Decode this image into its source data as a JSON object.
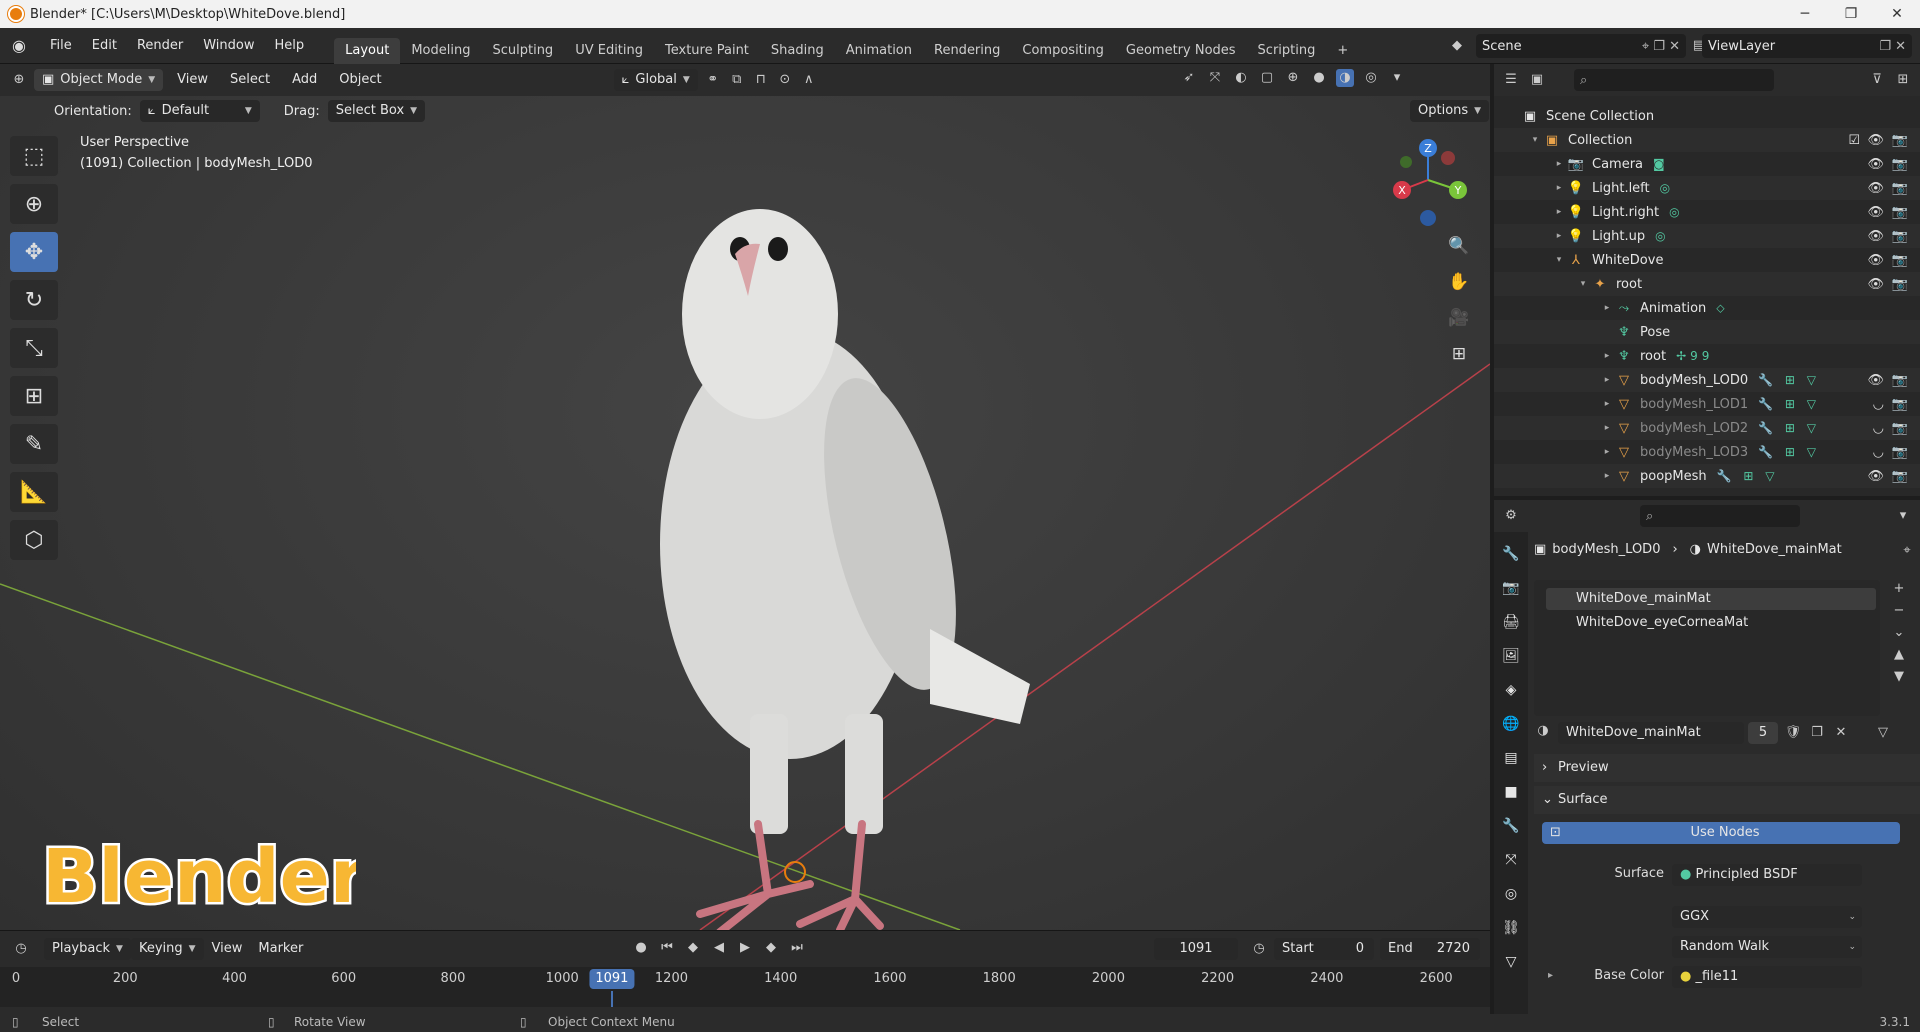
{
  "titlebar": {
    "title": "Blender* [C:\\Users\\M\\Desktop\\WhiteDove.blend]",
    "min": "─",
    "max": "❐",
    "close": "✕"
  },
  "menubar": {
    "menus": [
      "File",
      "Edit",
      "Render",
      "Window",
      "Help"
    ],
    "workspaces": [
      "Layout",
      "Modeling",
      "Sculpting",
      "UV Editing",
      "Texture Paint",
      "Shading",
      "Animation",
      "Rendering",
      "Compositing",
      "Geometry Nodes",
      "Scripting"
    ],
    "active_workspace": "Layout",
    "add_tab": "+",
    "scene": "Scene",
    "view_layer": "ViewLayer"
  },
  "viewport_header": {
    "mode": "Object Mode",
    "menus": [
      "View",
      "Select",
      "Add",
      "Object"
    ],
    "transform_orientation": "Global",
    "orientation_label": "Orientation:",
    "orientation_value": "Default",
    "drag_label": "Drag:",
    "drag_value": "Select Box",
    "options": "Options"
  },
  "viewport": {
    "perspective": "User Perspective",
    "collection_info": "(1091) Collection | bodyMesh_LOD0",
    "gizmo": {
      "x": "X",
      "y": "Y",
      "z": "Z"
    },
    "watermark": "Blender"
  },
  "timeline": {
    "menus": [
      "Playback",
      "Keying",
      "View",
      "Marker"
    ],
    "current_frame": "1091",
    "start_label": "Start",
    "start": "0",
    "end_label": "End",
    "end": "2720",
    "ticks": [
      "0",
      "200",
      "400",
      "600",
      "800",
      "1000",
      "1200",
      "1400",
      "1600",
      "1800",
      "2000",
      "2200",
      "2400",
      "2600"
    ]
  },
  "statusbar": {
    "select": "Select",
    "rotate": "Rotate View",
    "context": "Object Context Menu",
    "version": "3.3.1"
  },
  "outliner": {
    "root": "Scene Collection",
    "rows": [
      {
        "label": "Collection",
        "indent": 1,
        "icon": "collection-icon",
        "glyph": "▣",
        "expand": "▾",
        "vis": true
      },
      {
        "label": "Camera",
        "indent": 2,
        "icon": "camera-icon",
        "glyph": "📷",
        "expand": "▸",
        "vis": true,
        "extra": "◙"
      },
      {
        "label": "Light.left",
        "indent": 2,
        "icon": "light-icon",
        "glyph": "💡",
        "expand": "▸",
        "vis": true,
        "extra": "◎"
      },
      {
        "label": "Light.right",
        "indent": 2,
        "icon": "light-icon",
        "glyph": "💡",
        "expand": "▸",
        "vis": true,
        "extra": "◎"
      },
      {
        "label": "Light.up",
        "indent": 2,
        "icon": "light-icon",
        "glyph": "💡",
        "expand": "▸",
        "vis": true,
        "extra": "◎"
      },
      {
        "label": "WhiteDove",
        "indent": 2,
        "icon": "empty-icon",
        "glyph": "⅄",
        "expand": "▾",
        "vis": true
      },
      {
        "label": "root",
        "indent": 3,
        "icon": "armature-icon",
        "glyph": "✦",
        "expand": "▾",
        "vis": true
      },
      {
        "label": "Animation",
        "indent": 4,
        "icon": "animation-icon",
        "glyph": "⤳",
        "expand": "▸",
        "vis": false,
        "extra": "⬦"
      },
      {
        "label": "Pose",
        "indent": 4,
        "icon": "pose-icon",
        "glyph": "♆",
        "expand": "",
        "vis": false
      },
      {
        "label": "root",
        "indent": 4,
        "icon": "bone-icon",
        "glyph": "♆",
        "expand": "▸",
        "vis": false,
        "extra": "✢99"
      },
      {
        "label": "bodyMesh_LOD0",
        "indent": 4,
        "icon": "mesh-icon",
        "glyph": "▽",
        "expand": "▸",
        "vis": true,
        "extra": "🔧 ⊞ ▽"
      },
      {
        "label": "bodyMesh_LOD1",
        "indent": 4,
        "icon": "mesh-icon",
        "glyph": "▽",
        "expand": "▸",
        "vis": false,
        "hidden": true,
        "extra": "🔧 ⊞ ▽"
      },
      {
        "label": "bodyMesh_LOD2",
        "indent": 4,
        "icon": "mesh-icon",
        "glyph": "▽",
        "expand": "▸",
        "vis": false,
        "hidden": true,
        "extra": "🔧 ⊞ ▽"
      },
      {
        "label": "bodyMesh_LOD3",
        "indent": 4,
        "icon": "mesh-icon",
        "glyph": "▽",
        "expand": "▸",
        "vis": false,
        "hidden": true,
        "extra": "🔧 ⊞ ▽"
      },
      {
        "label": "poopMesh",
        "indent": 4,
        "icon": "mesh-icon",
        "glyph": "▽",
        "expand": "▸",
        "vis": true,
        "extra": "🔧 ⊞ ▽"
      }
    ]
  },
  "properties": {
    "breadcrumb_object": "bodyMesh_LOD0",
    "breadcrumb_material": "WhiteDove_mainMat",
    "slots": [
      "WhiteDove_mainMat",
      "WhiteDove_eyeCorneaMat"
    ],
    "material_name": "WhiteDove_mainMat",
    "user_count": "5",
    "preview": "Preview",
    "surface_panel": "Surface",
    "use_nodes": "Use Nodes",
    "surface_label": "Surface",
    "surface_value": "Principled BSDF",
    "distribution": "GGX",
    "subsurface_method": "Random Walk",
    "base_color_label": "Base Color",
    "base_color_value": "_file11"
  },
  "colors": {
    "accent": "#4772b3",
    "orange": "#e87d0d",
    "x_axis": "#d83a4a",
    "y_axis": "#7ac53a",
    "z_axis": "#3a7ed8"
  }
}
